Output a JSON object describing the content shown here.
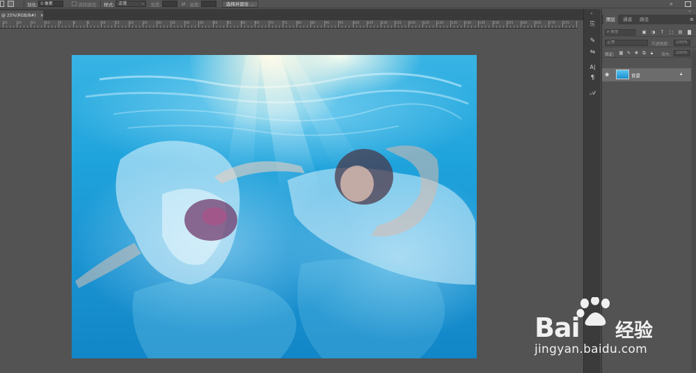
{
  "options_bar": {
    "feather_label": "羽化:",
    "feather_value": "0 像素",
    "antialias_label": "消除锯齿",
    "style_label": "样式:",
    "style_value": "正常",
    "width_label": "宽度:",
    "height_label": "高度:",
    "select_mask_button": "选择并遮住 ..."
  },
  "document_tab": {
    "title": "@ 25%(RGB/8#)",
    "close": "×"
  },
  "ruler": {
    "ticks": [
      "25",
      "20",
      "15",
      "10",
      "5",
      "0",
      "5",
      "10",
      "15",
      "20",
      "25",
      "30",
      "35",
      "40",
      "45",
      "50",
      "55",
      "60",
      "65",
      "70",
      "75",
      "80",
      "85",
      "90",
      "95",
      "100",
      "105",
      "110",
      "115",
      "120",
      "125",
      "130",
      "135",
      "140",
      "145",
      "150",
      "155",
      "160",
      "165",
      "170",
      "175",
      "180"
    ]
  },
  "layers_panel": {
    "tabs": [
      "图层",
      "通道",
      "路径"
    ],
    "active_tab": "图层",
    "filter_kind": "类型",
    "blend_mode": "正常",
    "opacity_label": "不透明度:",
    "opacity_value": "100%",
    "lock_label": "锁定:",
    "fill_label": "填充:",
    "fill_value": "100%",
    "layer_name": "背景"
  },
  "tool_strip": {
    "icons": [
      "history-icon",
      "brush-settings-icon",
      "adjust-icon",
      "character-icon",
      "paragraph-icon",
      "glyphs-icon"
    ]
  },
  "watermark": {
    "brand": "Bai",
    "brand_cn": "经验",
    "url": "jingyan.baidu.com"
  },
  "colors": {
    "workspace": "#535353",
    "panel_dark": "#3b3b3b",
    "water_blue": "#1a94d3"
  }
}
